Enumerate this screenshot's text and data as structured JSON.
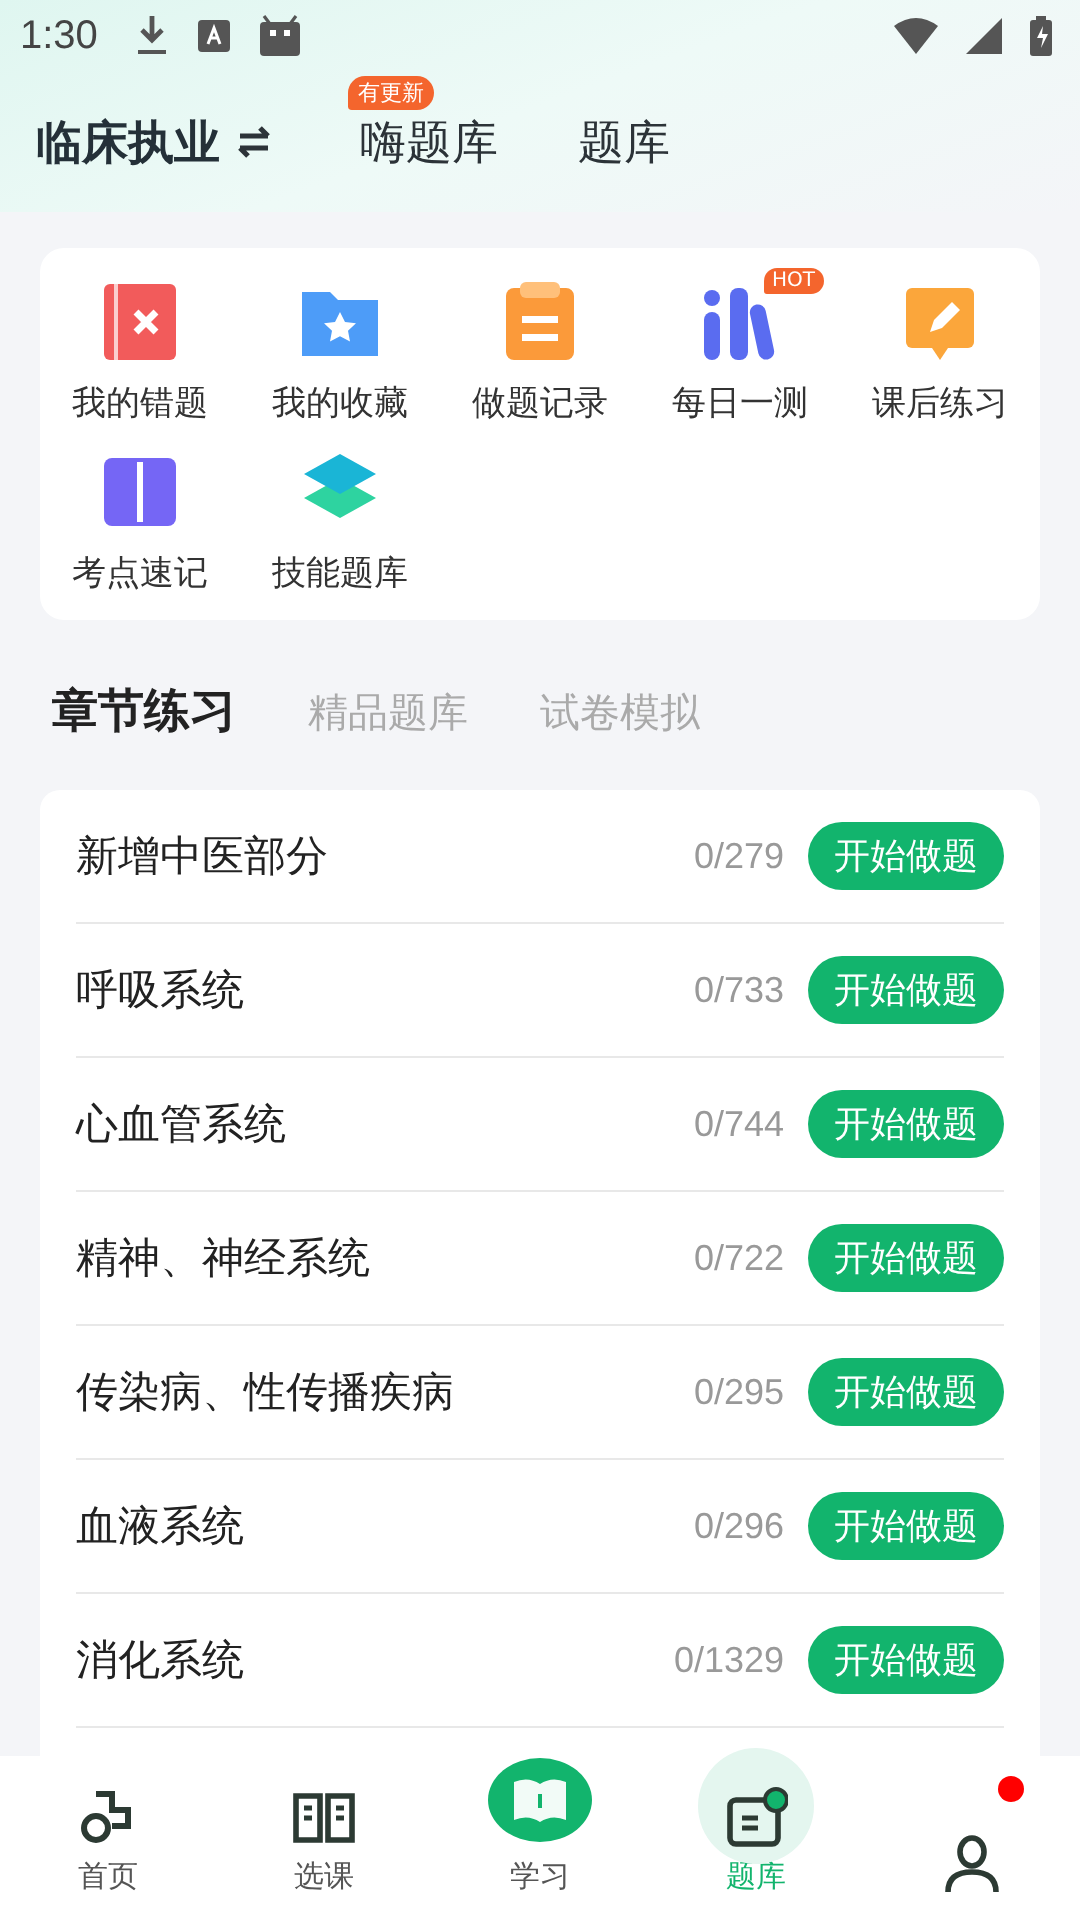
{
  "status_bar": {
    "time": "1:30"
  },
  "header": {
    "exam": "临床执业",
    "tabs": [
      {
        "label": "嗨题库",
        "badge": "有更新"
      },
      {
        "label": "题库"
      }
    ]
  },
  "shortcuts": [
    {
      "label": "我的错题"
    },
    {
      "label": "我的收藏"
    },
    {
      "label": "做题记录"
    },
    {
      "label": "每日一测",
      "badge": "HOT"
    },
    {
      "label": "课后练习"
    },
    {
      "label": "考点速记"
    },
    {
      "label": "技能题库"
    }
  ],
  "section_tabs": [
    {
      "label": "章节练习",
      "selected": true
    },
    {
      "label": "精品题库",
      "selected": false
    },
    {
      "label": "试卷模拟",
      "selected": false
    }
  ],
  "chapters": [
    {
      "title": "新增中医部分",
      "progress": "0/279",
      "action": "开始做题"
    },
    {
      "title": "呼吸系统",
      "progress": "0/733",
      "action": "开始做题"
    },
    {
      "title": "心血管系统",
      "progress": "0/744",
      "action": "开始做题"
    },
    {
      "title": "精神、神经系统",
      "progress": "0/722",
      "action": "开始做题"
    },
    {
      "title": "传染病、性传播疾病",
      "progress": "0/295",
      "action": "开始做题"
    },
    {
      "title": "血液系统",
      "progress": "0/296",
      "action": "开始做题"
    },
    {
      "title": "消化系统",
      "progress": "0/1329",
      "action": "开始做题"
    }
  ],
  "bottom_nav": [
    {
      "kind": "tab",
      "label": "首页",
      "selected": false
    },
    {
      "kind": "tab",
      "label": "选课",
      "selected": false
    },
    {
      "kind": "center",
      "label": "学习",
      "selected": false
    },
    {
      "kind": "tab",
      "label": "题库",
      "selected": true
    },
    {
      "kind": "tab",
      "selected": false,
      "dot": true
    }
  ]
}
